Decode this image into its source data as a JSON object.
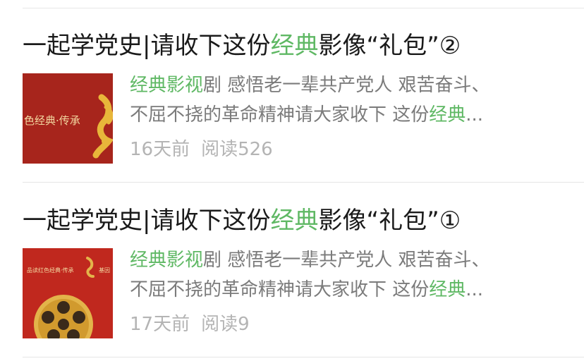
{
  "articles": [
    {
      "title_prefix": "一起学党史|请收下这份",
      "title_highlight": "经典",
      "title_suffix": "影像“礼包”②",
      "snippet_highlight_1": "经典影视",
      "snippet_line1_rest": "剧 感悟老一辈共产党人 艰苦奋斗、",
      "snippet_line2_text": "不屈不挠的革命精神请大家收下 这份",
      "snippet_highlight_2": "经典",
      "snippet_ellipsis": "...",
      "time": "16天前",
      "reads": "阅读526",
      "thumb_text": "色经典·传承",
      "thumb_colors": {
        "bg": "#b0281f",
        "gold": "#e8b63a"
      }
    },
    {
      "title_prefix": "一起学党史|请收下这份",
      "title_highlight": "经典",
      "title_suffix": "影像“礼包”①",
      "snippet_highlight_1": "经典影视",
      "snippet_line1_rest": "剧 感悟老一辈共产党人 艰苦奋斗、",
      "snippet_line2_text": "不屈不挠的革命精神请大家收下 这份",
      "snippet_highlight_2": "经典",
      "snippet_ellipsis": "...",
      "time": "17天前",
      "reads": "阅读9",
      "thumb_text": "品读红色经典·传承",
      "thumb_text_right": "基因",
      "thumb_colors": {
        "bg": "#c0281e",
        "gold": "#e3b44a",
        "reel": "#3a2a1a"
      }
    }
  ],
  "colors": {
    "highlight": "#5fb864",
    "title": "#1a1a1a",
    "snippet": "#7b7b7b",
    "meta": "#b4b4b4",
    "divider": "#e6e6e6"
  }
}
